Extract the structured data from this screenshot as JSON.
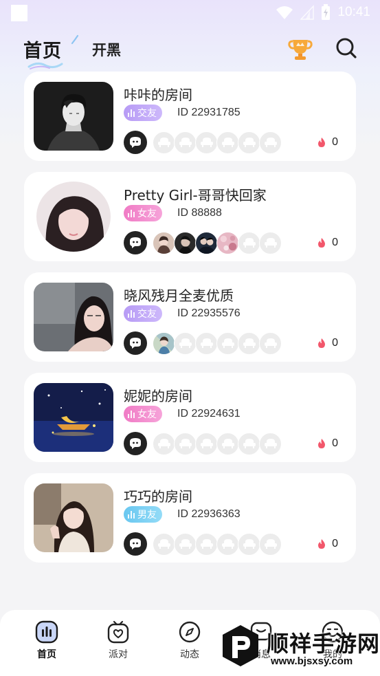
{
  "status_bar": {
    "time": "10:41",
    "icons": [
      "wifi-icon",
      "signal-icon",
      "battery-icon"
    ]
  },
  "header": {
    "tabs": [
      {
        "label": "首页",
        "active": true
      },
      {
        "label": "开黑",
        "active": false
      }
    ],
    "trophy_icon": "trophy-icon",
    "search_icon": "search-icon"
  },
  "rooms": [
    {
      "name": "咔咔的房间",
      "tag": "交友",
      "tag_color": "#b79bf5",
      "id_text": "ID 22931785",
      "heat": "0",
      "occupied_seats": 0,
      "seats_total": 6
    },
    {
      "name": "Pretty Girl-哥哥快回家",
      "tag": "女友",
      "tag_color": "#f07bc5",
      "id_text": "ID 88888",
      "heat": "0",
      "occupied_seats": 4,
      "seats_total": 6
    },
    {
      "name": "晓风残月全麦优质",
      "tag": "交友",
      "tag_color": "#b79bf5",
      "id_text": "ID 22935576",
      "heat": "0",
      "occupied_seats": 1,
      "seats_total": 6
    },
    {
      "name": "妮妮的房间",
      "tag": "女友",
      "tag_color": "#f07bc5",
      "id_text": "ID 22924631",
      "heat": "0",
      "occupied_seats": 0,
      "seats_total": 6
    },
    {
      "name": "巧巧的房间",
      "tag": "男友",
      "tag_color": "#69c7f0",
      "id_text": "ID 22936363",
      "heat": "0",
      "occupied_seats": 0,
      "seats_total": 6
    }
  ],
  "bottom_nav": [
    {
      "label": "首页",
      "icon": "home-icon",
      "active": true
    },
    {
      "label": "派对",
      "icon": "party-icon",
      "active": false
    },
    {
      "label": "动态",
      "icon": "compass-icon",
      "active": false
    },
    {
      "label": "消息",
      "icon": "message-icon",
      "active": false
    },
    {
      "label": "我的",
      "icon": "profile-icon",
      "active": false
    }
  ],
  "watermark": {
    "title": "顺祥手游网",
    "url": "www.bjsxsy.com"
  },
  "colors": {
    "accent_purple": "#b79bf5",
    "accent_pink": "#f07bc5",
    "accent_blue": "#69c7f0",
    "heat_red": "#f2576b"
  }
}
